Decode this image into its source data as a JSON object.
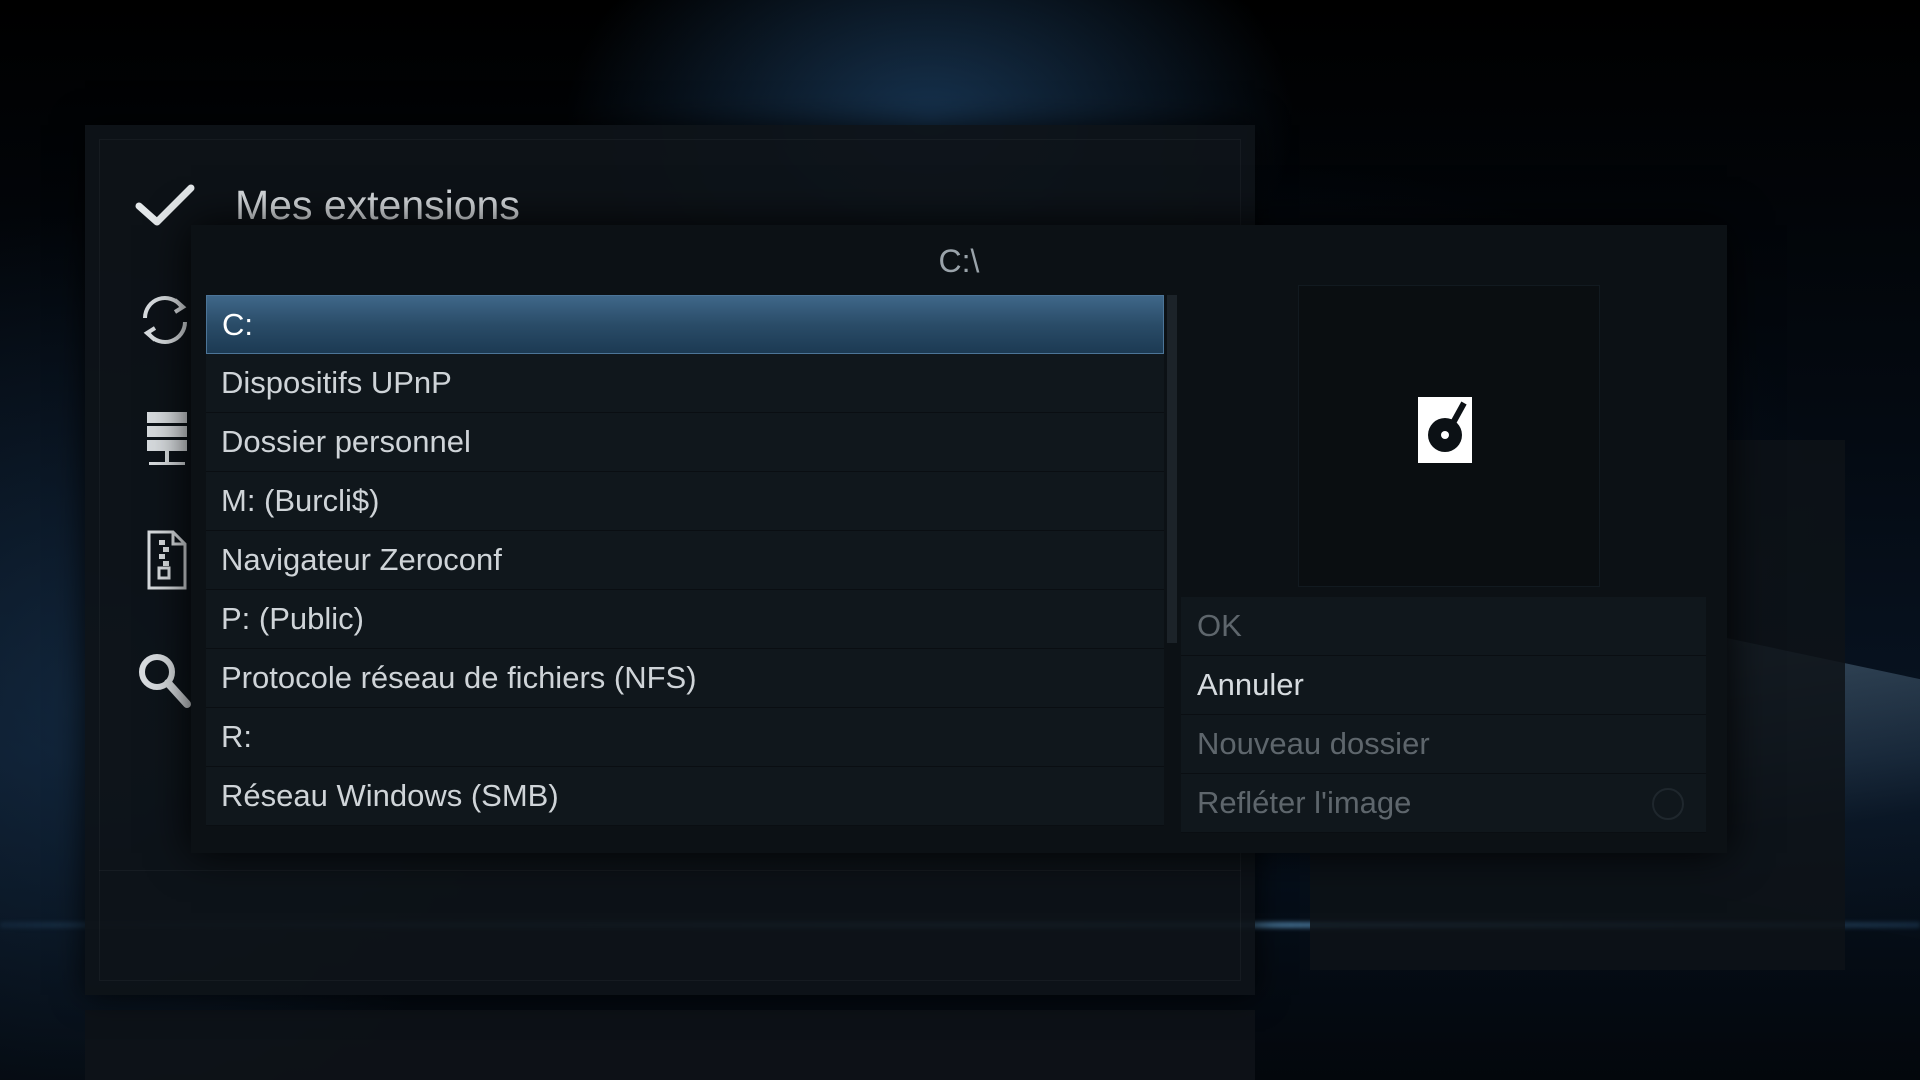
{
  "addon_window": {
    "title": "Mes extensions",
    "side_icons": [
      "check-icon",
      "refresh-icon",
      "server-icon",
      "zip-file-icon",
      "search-icon"
    ]
  },
  "dialog": {
    "path": "C:\\",
    "items": [
      {
        "label": "C:",
        "selected": true
      },
      {
        "label": "Dispositifs UPnP",
        "selected": false
      },
      {
        "label": "Dossier personnel",
        "selected": false
      },
      {
        "label": "M: (Burcli$)",
        "selected": false
      },
      {
        "label": "Navigateur Zeroconf",
        "selected": false
      },
      {
        "label": "P: (Public)",
        "selected": false
      },
      {
        "label": "Protocole réseau de fichiers (NFS)",
        "selected": false
      },
      {
        "label": "R:",
        "selected": false
      },
      {
        "label": "Réseau Windows (SMB)",
        "selected": false
      }
    ],
    "thumbnail_icon": "hard-drive-icon",
    "buttons": {
      "ok": "OK",
      "cancel": "Annuler",
      "new_folder": "Nouveau dossier",
      "flip_image": "Refléter l'image"
    },
    "colors": {
      "selected_item": "#2f5474",
      "panel_bg": "#10171c"
    }
  }
}
